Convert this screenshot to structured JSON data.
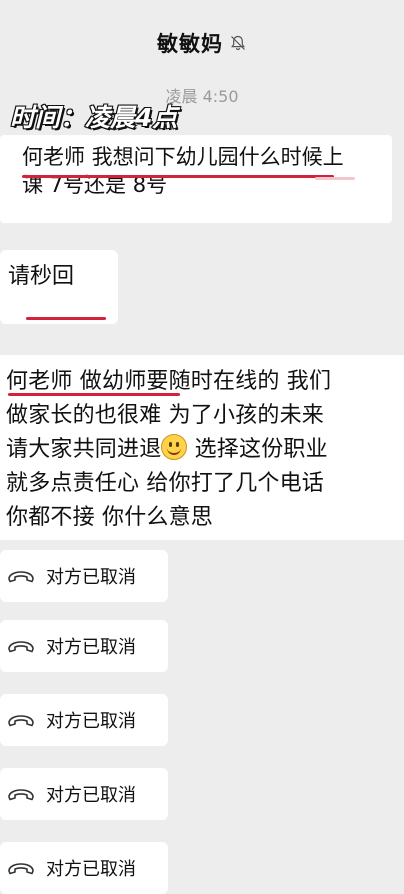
{
  "header": {
    "title": "敏敏妈",
    "mute_icon": "bell-muted-icon"
  },
  "timestamp": "凌晨 4:50",
  "overlay_caption": "时间：凌晨4点",
  "messages": [
    {
      "line1": "何老师 我想问下幼儿园什么时候上",
      "line2": "课 7号还是 8号"
    },
    {
      "text": "请秒回"
    },
    {
      "line1": "何老师 做幼师要随时在线的 我们",
      "line2": "做家长的也很难 为了小孩的未来",
      "line3a": "请大家共同进退",
      "line3b": " 选择这份职业",
      "line4": "就多点责任心 给你打了几个电话",
      "line5": "你都不接 你什么意思",
      "emoji": "smile-emoji"
    }
  ],
  "calls": [
    {
      "label": "对方已取消",
      "icon": "phone-hangup-icon"
    },
    {
      "label": "对方已取消",
      "icon": "phone-hangup-icon"
    },
    {
      "label": "对方已取消",
      "icon": "phone-hangup-icon"
    },
    {
      "label": "对方已取消",
      "icon": "phone-hangup-icon"
    },
    {
      "label": "对方已取消",
      "icon": "phone-hangup-icon"
    }
  ],
  "colors": {
    "background": "#ededed",
    "bubble": "#ffffff",
    "underline": "#d4223a"
  }
}
